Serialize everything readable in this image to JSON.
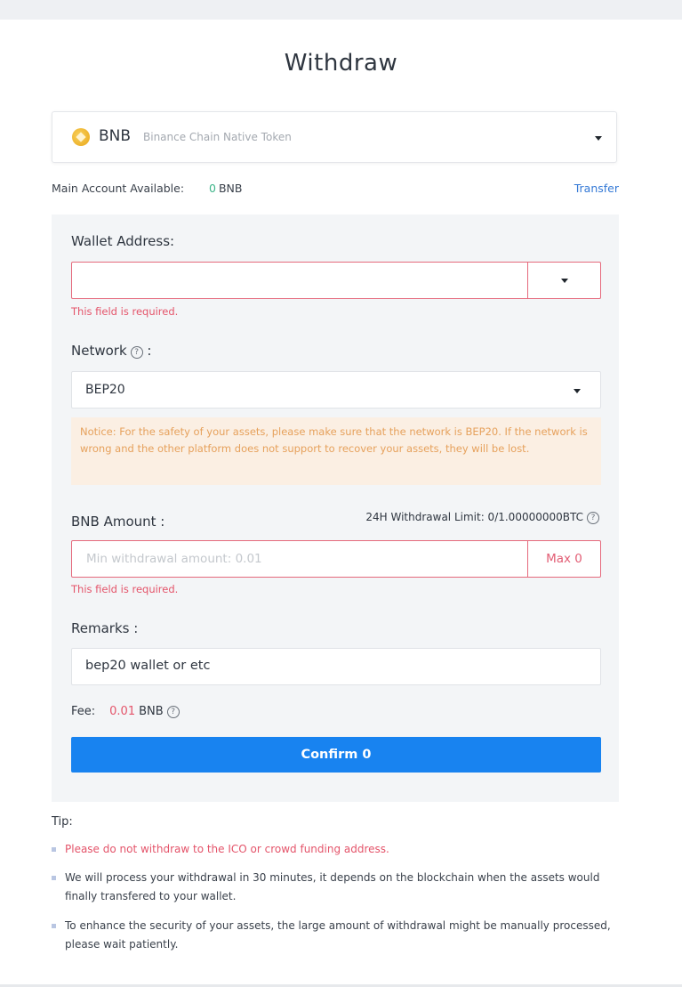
{
  "page": {
    "title": "Withdraw"
  },
  "coin": {
    "symbol": "BNB",
    "name": "Binance Chain Native Token",
    "logo_icon": "bnb-coin-icon"
  },
  "account": {
    "available_label": "Main Account Available:",
    "available_amount": "0",
    "available_unit": "BNB",
    "transfer_label": "Transfer"
  },
  "form": {
    "wallet_address": {
      "label": "Wallet Address:",
      "value": "",
      "error": "This field is required."
    },
    "network": {
      "label": "Network",
      "label_suffix": ":",
      "value": "BEP20"
    },
    "notice": "Notice: For the safety of your assets, please make sure that the network is BEP20. If the network is wrong and the other platform does not support to recover your assets, they will be lost.",
    "amount": {
      "label": "BNB Amount :",
      "limit": "24H Withdrawal Limit: 0/1.00000000BTC",
      "placeholder": "Min withdrawal amount: 0.01",
      "max_label": "Max 0",
      "error": "This field is required."
    },
    "remarks": {
      "label": "Remarks :",
      "value": "bep20 wallet or etc"
    },
    "fee": {
      "label": "Fee:",
      "amount": "0.01",
      "unit": "BNB"
    },
    "confirm_label": "Confirm 0"
  },
  "tips": {
    "title": "Tip:",
    "items": [
      "Please do not withdraw to the ICO or crowd funding address.",
      "We will process your withdrawal in 30 minutes, it depends on the blockchain when the assets would finally transfered to your wallet.",
      "To enhance the security of your assets, the large amount of withdrawal might be manually processed, please wait patiently."
    ]
  },
  "colors": {
    "primary": "#1883f0",
    "error": "#e4546a",
    "notice_bg": "#fbefe3",
    "notice_text": "#e6a15c",
    "available_green": "#3fb58a",
    "link": "#3479d6"
  }
}
